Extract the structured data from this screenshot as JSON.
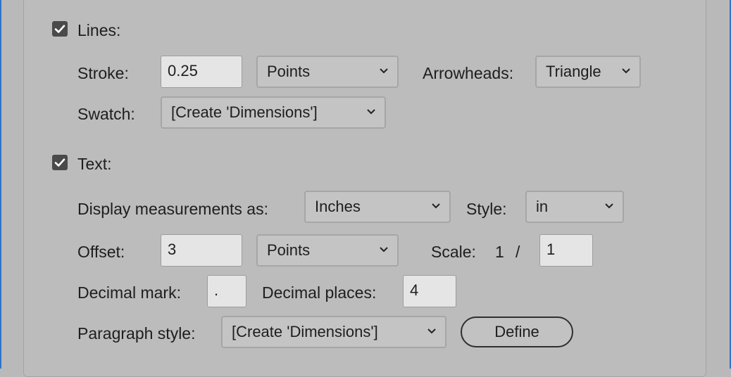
{
  "lines": {
    "checkbox_label": "Lines:",
    "stroke_label": "Stroke:",
    "stroke_value": "0.25",
    "stroke_unit": "Points",
    "arrowheads_label": "Arrowheads:",
    "arrowheads_value": "Triangle",
    "swatch_label": "Swatch:",
    "swatch_value": "[Create 'Dimensions']"
  },
  "text": {
    "checkbox_label": "Text:",
    "display_label": "Display measurements as:",
    "display_value": "Inches",
    "style_label": "Style:",
    "style_value": "in",
    "offset_label": "Offset:",
    "offset_value": "3",
    "offset_unit": "Points",
    "scale_label": "Scale:",
    "scale_numerator": "1",
    "scale_separator": "/",
    "scale_denominator": "1",
    "decimal_mark_label": "Decimal mark:",
    "decimal_mark_value": ".",
    "decimal_places_label": "Decimal places:",
    "decimal_places_value": "4",
    "paragraph_style_label": "Paragraph style:",
    "paragraph_style_value": "[Create 'Dimensions']",
    "define_button": "Define"
  },
  "colors": {
    "accent_edge": "#2f74c9",
    "checkbox_fill": "#4a4a4a"
  },
  "icons": {
    "checkbox_mark": "check-icon",
    "dropdown": "chevron-down-icon"
  }
}
